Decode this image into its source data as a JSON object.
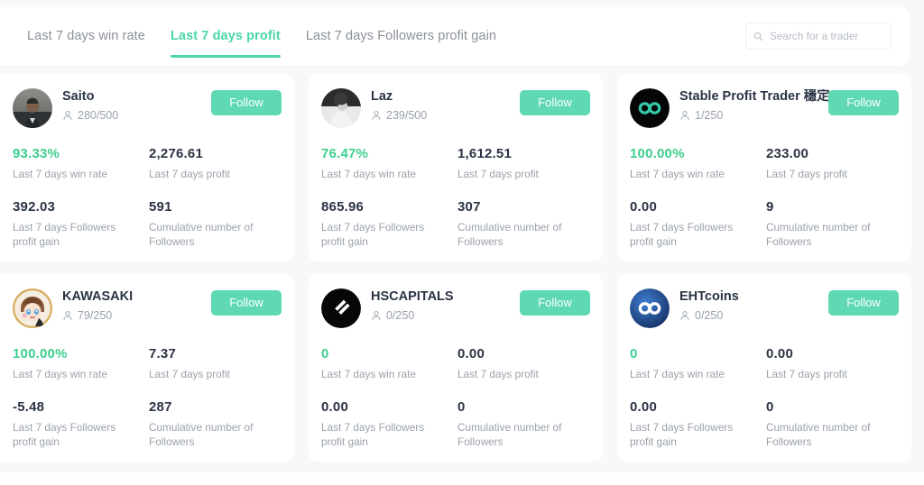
{
  "header": {
    "tabs": [
      {
        "label": "Last 7 days win rate",
        "active": false
      },
      {
        "label": "Last 7 days profit",
        "active": true
      },
      {
        "label": "Last 7 days Followers profit gain",
        "active": false
      }
    ],
    "search": {
      "placeholder": "Search for a trader",
      "value": "",
      "icon": "search-icon"
    }
  },
  "labels": {
    "win_rate": "Last 7 days win rate",
    "profit": "Last 7 days profit",
    "followers_gain": "Last 7 days Followers profit gain",
    "cumulative_followers": "Cumulative number of Followers",
    "follow": "Follow"
  },
  "colors": {
    "accent": "#4ad6ab",
    "follow_button": "#5fd9b4",
    "positive": "#3ecf8e",
    "text_primary": "#2b3445",
    "text_muted": "#9aa1ab",
    "page_background": "#f7f9f9",
    "card_background": "#ffffff"
  },
  "cards": [
    {
      "name": "Saito",
      "slots": "280/500",
      "avatar": "photo-man-suit",
      "win_rate": "93.33%",
      "profit": "2,276.61",
      "followers_gain": "392.03",
      "cumulative_followers": "591",
      "follow": "Follow"
    },
    {
      "name": "Laz",
      "slots": "239/500",
      "avatar": "photo-bw-person",
      "win_rate": "76.47%",
      "profit": "1,612.51",
      "followers_gain": "865.96",
      "cumulative_followers": "307",
      "follow": "Follow"
    },
    {
      "name": "Stable Profit Trader 穩定...",
      "slots": "1/250",
      "avatar": "infinity-teal-black",
      "win_rate": "100.00%",
      "profit": "233.00",
      "followers_gain": "0.00",
      "cumulative_followers": "9",
      "follow": "Follow"
    },
    {
      "name": "KAWASAKI",
      "slots": "79/250",
      "avatar": "anime-girl",
      "win_rate": "100.00%",
      "profit": "7.37",
      "followers_gain": "-5.48",
      "cumulative_followers": "287",
      "follow": "Follow"
    },
    {
      "name": "HSCAPITALS",
      "slots": "0/250",
      "avatar": "s-logo-black",
      "win_rate": "0",
      "profit": "0.00",
      "followers_gain": "0.00",
      "cumulative_followers": "0",
      "follow": "Follow"
    },
    {
      "name": "EHTcoins",
      "slots": "0/250",
      "avatar": "infinity-blue",
      "win_rate": "0",
      "profit": "0.00",
      "followers_gain": "0.00",
      "cumulative_followers": "0",
      "follow": "Follow"
    }
  ]
}
